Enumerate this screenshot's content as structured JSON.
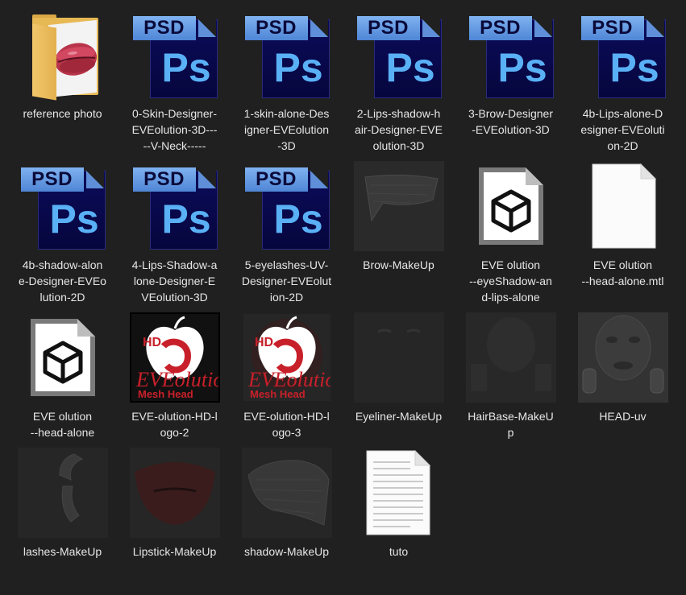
{
  "files": [
    {
      "label": "reference photo",
      "icon": "folder-photo-icon"
    },
    {
      "label": "0-Skin-Designer-\nEVEolution-3D---\n--V-Neck-----",
      "icon": "psd-file-icon"
    },
    {
      "label": "1-skin-alone-Des\nigner-EVEolution\n-3D",
      "icon": "psd-file-icon"
    },
    {
      "label": "2-Lips-shadow-h\nair-Designer-EVE\nolution-3D",
      "icon": "psd-file-icon"
    },
    {
      "label": "3-Brow-Designer\n-EVEolution-3D",
      "icon": "psd-file-icon"
    },
    {
      "label": "4b-Lips-alone-D\nesigner-EVEoluti\non-2D",
      "icon": "psd-file-icon"
    },
    {
      "label": "4b-shadow-alon\ne-Designer-EVEo\nlution-2D",
      "icon": "psd-file-icon"
    },
    {
      "label": "4-Lips-Shadow-a\nlone-Designer-E\nVEolution-3D",
      "icon": "psd-file-icon"
    },
    {
      "label": "5-eyelashes-UV-\nDesigner-EVEolut\nion-2D",
      "icon": "psd-file-icon"
    },
    {
      "label": "Brow-MakeUp",
      "icon": "texture-thumbnail-icon"
    },
    {
      "label": "EVE olution\n--eyeShadow-an\nd-lips-alone",
      "icon": "3d-object-file-icon"
    },
    {
      "label": "EVE olution\n--head-alone.mtl",
      "icon": "blank-document-icon"
    },
    {
      "label": "EVE olution\n--head-alone",
      "icon": "3d-object-file-icon"
    },
    {
      "label": "EVE-olution-HD-l\nogo-2",
      "icon": "logo-thumbnail-icon"
    },
    {
      "label": "EVE-olution-HD-l\nogo-3",
      "icon": "logo-thumbnail-icon"
    },
    {
      "label": "Eyeliner-MakeUp",
      "icon": "texture-thumbnail-icon"
    },
    {
      "label": "HairBase-MakeU\np",
      "icon": "texture-thumbnail-icon"
    },
    {
      "label": "HEAD-uv",
      "icon": "texture-thumbnail-icon"
    },
    {
      "label": "lashes-MakeUp",
      "icon": "texture-thumbnail-icon"
    },
    {
      "label": "Lipstick-MakeUp",
      "icon": "texture-thumbnail-icon"
    },
    {
      "label": "shadow-MakeUp",
      "icon": "texture-thumbnail-icon"
    },
    {
      "label": "tuto",
      "icon": "text-document-icon"
    }
  ],
  "psd_banner": "PSD",
  "ps_glyph": "Ps",
  "logo_text_top": "HD",
  "logo_text_main": "EVEolution",
  "logo_text_bottom": "Mesh Head",
  "colors": {
    "background": "#202020",
    "label": "#e6e6e6",
    "psd_body": "#0b0b5a",
    "psd_banner": "#6ea0e6",
    "ps_glyph": "#5ab0f5",
    "logo_red": "#c8202a"
  }
}
